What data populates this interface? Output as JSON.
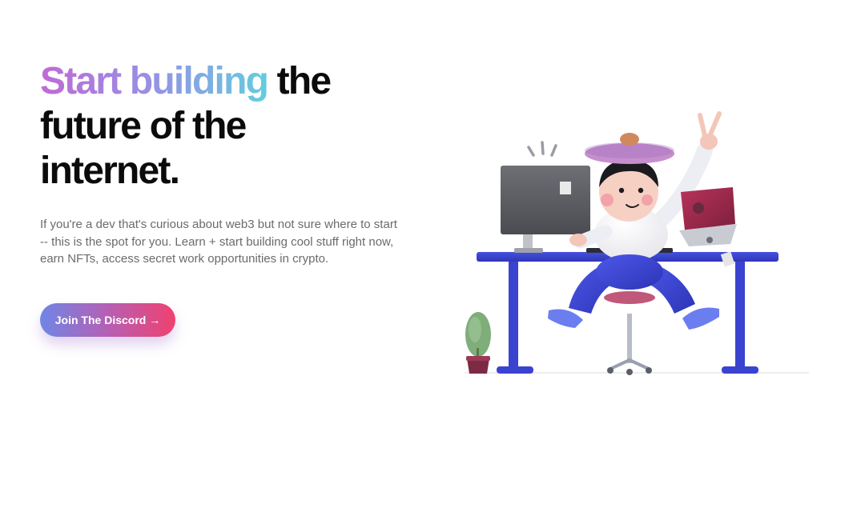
{
  "hero": {
    "headline_highlight": "Start building",
    "headline_line1_rest": " the",
    "headline_line2": "future of the",
    "headline_line3": "internet.",
    "description": "If you're a dev that's curious about web3 but not sure where to start -- this is the spot for you. Learn + start building cool stuff right now, earn NFTs, access secret work opportunities in crypto.",
    "cta_label": "Join The Discord →"
  },
  "colors": {
    "gradient_text": [
      "#c06ad6",
      "#9a8de3",
      "#63cde0"
    ],
    "button_gradient": [
      "#6f86e6",
      "#b65fb4",
      "#f0416f"
    ],
    "headline": "#0b0b0b",
    "body_text": "#6b6b6b",
    "desk": "#3b45d6"
  },
  "illustration": {
    "subject": "developer-at-desk-illustration"
  }
}
